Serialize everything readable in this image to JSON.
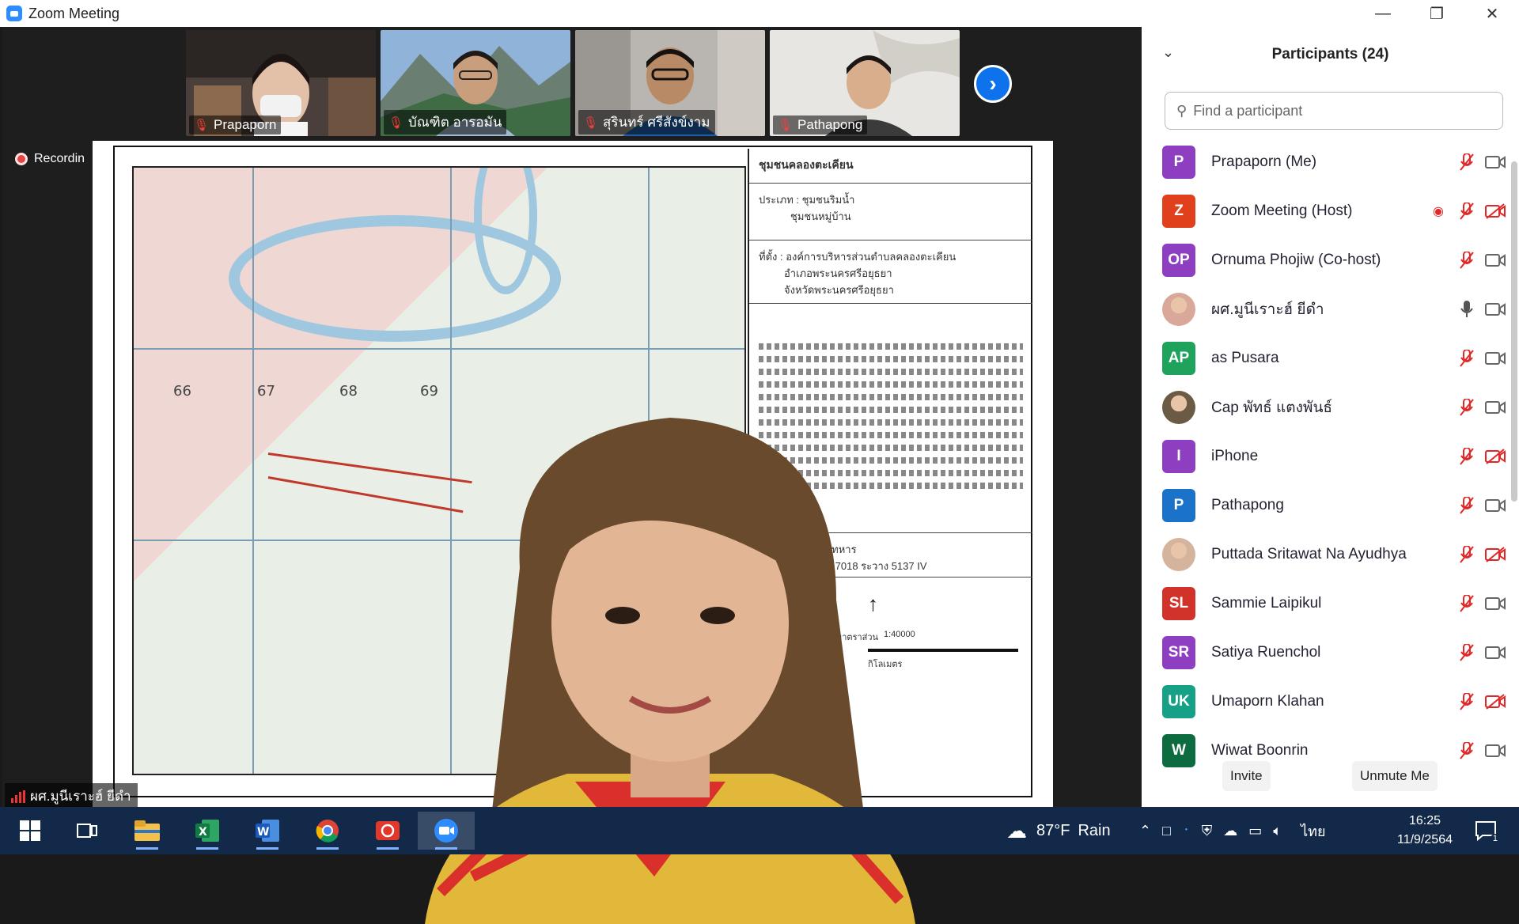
{
  "window": {
    "title": "Zoom Meeting"
  },
  "gallery": {
    "thumbs": [
      {
        "name": "Prapaporn"
      },
      {
        "name": "บัณฑิต อารอมัน"
      },
      {
        "name": "สุรินทร์ ศรีสังข์งาม"
      },
      {
        "name": "Pathapong"
      }
    ]
  },
  "recording_label": "Recordin",
  "speaker_name": "ผศ.มูนีเราะฮ์ ยีดำ",
  "map": {
    "grid_numbers": [
      "66",
      "67",
      "68",
      "69"
    ],
    "legend_title": "ชุมชนคลองตะเคียน",
    "legend_type": "ประเภท : ชุมชนริมน้ำ",
    "legend_type2": "ชุมชนหมู่บ้าน",
    "legend_loc": "ที่ตั้ง : องค์การบริหารส่วนตำบลคลองตะเคียน",
    "legend_loc2": "อำเภอพระนครศรีอยุธยา",
    "legend_loc3": "จังหวัดพระนครศรีอยุธยา",
    "legend_src": "ที่มา : กรมแผนที่ทหาร",
    "legend_src2": "แผนที่ลำดับชุด L 7018 ระวาง 5137 IV",
    "scale": "1:40000",
    "scale_label": "มาตราส่วน",
    "unit": "กิโลเมตร"
  },
  "panel": {
    "title": "Participants (24)",
    "search_placeholder": "Find a participant",
    "participants": [
      {
        "name": "Prapaporn (Me)",
        "initials": "P",
        "color": "#8e3fc1",
        "mic": "off",
        "cam": "on",
        "rec": false
      },
      {
        "name": "Zoom Meeting (Host)",
        "initials": "Z",
        "color": "#e0401c",
        "mic": "off",
        "cam": "off",
        "rec": true
      },
      {
        "name": "Ornuma Phojiw (Co-host)",
        "initials": "OP",
        "color": "#8e3fc1",
        "mic": "off",
        "cam": "on",
        "rec": false
      },
      {
        "name": "ผศ.มูนีเราะฮ์ ยีดำ",
        "initials": "",
        "color": "#d9a89a",
        "mic": "on",
        "cam": "on",
        "rec": false
      },
      {
        "name": "as Pusara",
        "initials": "AP",
        "color": "#1fa35c",
        "mic": "off",
        "cam": "on",
        "rec": false
      },
      {
        "name": "Cap พัทธ์ แตงพันธ์",
        "initials": "",
        "color": "#6b5a44",
        "mic": "off",
        "cam": "on",
        "rec": false
      },
      {
        "name": "iPhone",
        "initials": "I",
        "color": "#8e3fc1",
        "mic": "off",
        "cam": "off",
        "rec": false
      },
      {
        "name": "Pathapong",
        "initials": "P",
        "color": "#1b73c9",
        "mic": "off",
        "cam": "on",
        "rec": false
      },
      {
        "name": "Puttada Sritawat Na Ayudhya",
        "initials": "",
        "color": "#d4b49c",
        "mic": "off",
        "cam": "off",
        "rec": false
      },
      {
        "name": "Sammie Laipikul",
        "initials": "SL",
        "color": "#d1332b",
        "mic": "off",
        "cam": "on",
        "rec": false
      },
      {
        "name": "Satiya Ruenchol",
        "initials": "SR",
        "color": "#8e3fc1",
        "mic": "off",
        "cam": "on",
        "rec": false
      },
      {
        "name": "Umaporn Klahan",
        "initials": "UK",
        "color": "#16a085",
        "mic": "off",
        "cam": "off",
        "rec": false
      },
      {
        "name": "Wiwat Boonrin",
        "initials": "W",
        "color": "#0c6b3f",
        "mic": "off",
        "cam": "on",
        "rec": false
      }
    ],
    "invite_label": "Invite",
    "unmute_label": "Unmute Me"
  },
  "taskbar": {
    "weather_temp": "87°F",
    "weather_desc": "Rain",
    "language": "ไทย",
    "time": "16:25",
    "date": "11/9/2564",
    "notification_count": "1"
  },
  "colors": {
    "zoom_blue": "#0e72ed",
    "taskbar": "#13294a",
    "mute_red": "#e02828"
  }
}
